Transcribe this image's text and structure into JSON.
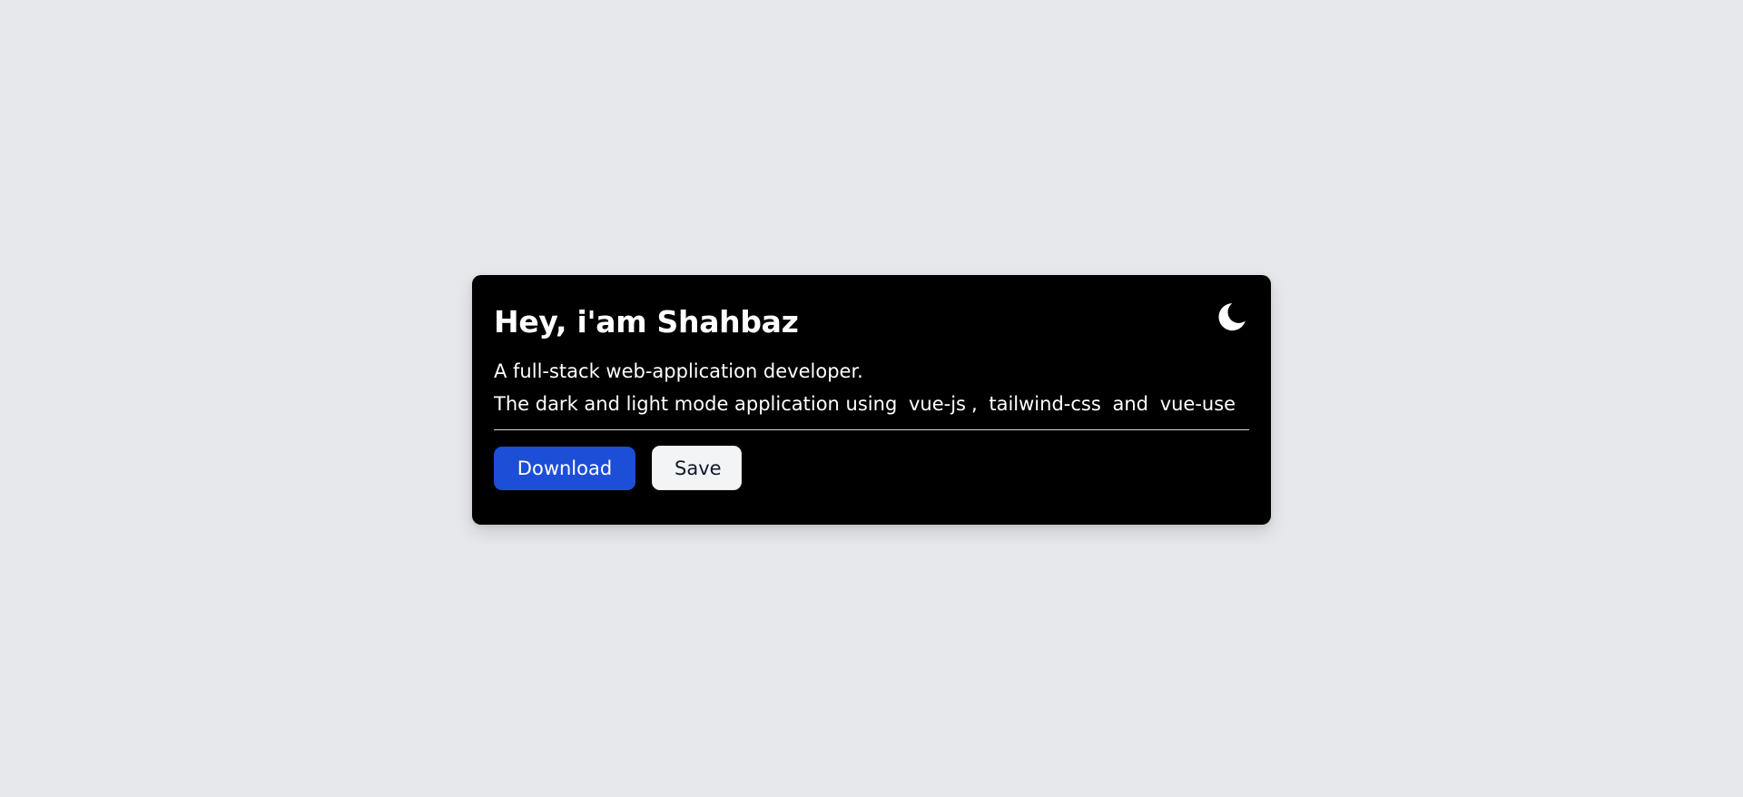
{
  "card": {
    "title": "Hey, i'am Shahbaz",
    "theme_toggle_icon": "moon-icon",
    "description_line1": "A full-stack web-application developer.",
    "description_line2_prefix": "The dark and light mode application using",
    "tech1": "vue-js",
    "comma": ",",
    "tech2": "tailwind-css",
    "and_word": "and",
    "tech3": "vue-use",
    "primary_button": "Download",
    "secondary_button": "Save"
  },
  "colors": {
    "page_background": "#e5e7eb",
    "card_background": "#000000",
    "primary_button": "#1d4ed8",
    "secondary_button": "#f3f4f6",
    "text": "#ffffff"
  }
}
